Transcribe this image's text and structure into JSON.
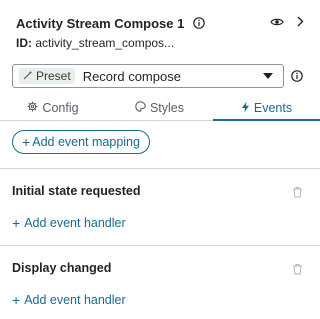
{
  "header": {
    "title": "Activity Stream Compose 1",
    "id_key": "ID:",
    "id_value": "activity_stream_compos..."
  },
  "preset": {
    "tag_label": "Preset",
    "value": "Record compose"
  },
  "tabs": [
    {
      "label": "Config",
      "icon": "gear-icon"
    },
    {
      "label": "Styles",
      "icon": "palette-icon"
    },
    {
      "label": "Events",
      "icon": "lightning-icon",
      "active": true
    }
  ],
  "actions": {
    "add_event_mapping": "Add event mapping"
  },
  "sections": [
    {
      "title": "Initial state requested",
      "add_label": "Add event handler"
    },
    {
      "title": "Display changed",
      "add_label": "Add event handler"
    }
  ],
  "colors": {
    "accent": "#1b6b8f",
    "preset_tag_bg": "#e6efe9",
    "border": "#d0d7de"
  }
}
